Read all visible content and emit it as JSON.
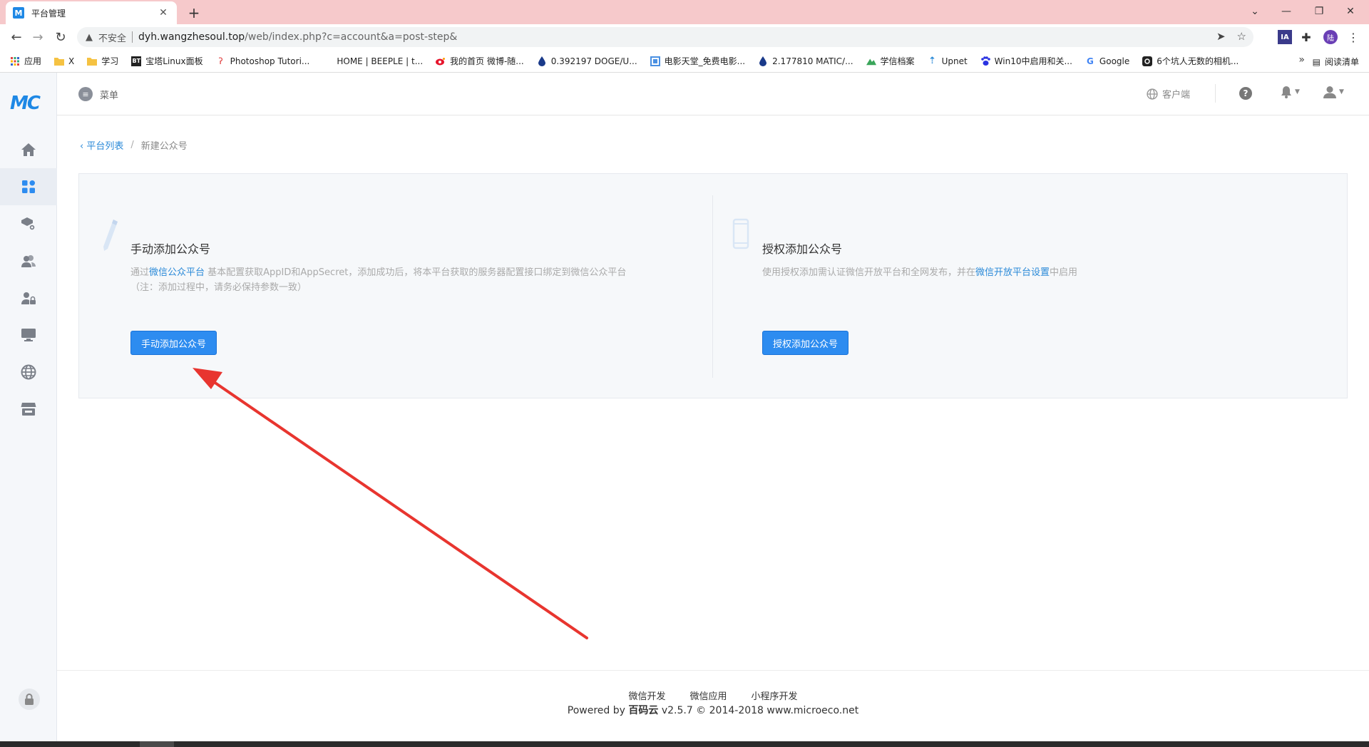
{
  "browser": {
    "tab_title": "平台管理",
    "tab_favicon_letter": "M",
    "url_security": "不安全",
    "url_host": "dyh.wangzhesoul.top",
    "url_path": "/web/index.php?c=account&a=post-step&",
    "profile_initial": "陆",
    "ext_label": "IA",
    "bookmarks": [
      {
        "label": "应用",
        "icon": "apps-grid-icon"
      },
      {
        "label": "X",
        "icon": "folder-icon"
      },
      {
        "label": "学习",
        "icon": "folder-icon"
      },
      {
        "label": "宝塔Linux面板",
        "icon": "bt-icon",
        "icon_text": "BT"
      },
      {
        "label": "Photoshop Tutori...",
        "icon": "photoshop-icon"
      },
      {
        "label": "HOME | BEEPLE | t...",
        "icon": "blank-icon"
      },
      {
        "label": "我的首页 微博-随...",
        "icon": "weibo-icon"
      },
      {
        "label": "0.392197 DOGE/U...",
        "icon": "drop-icon"
      },
      {
        "label": "电影天堂_免费电影...",
        "icon": "film-icon"
      },
      {
        "label": "2.177810 MATIC/...",
        "icon": "drop-icon"
      },
      {
        "label": "学信档案",
        "icon": "chsi-icon"
      },
      {
        "label": "Upnet",
        "icon": "upnet-icon"
      },
      {
        "label": "Win10中启用和关...",
        "icon": "baidu-icon"
      },
      {
        "label": "Google",
        "icon": "google-icon"
      },
      {
        "label": "6个坑人无数的相机...",
        "icon": "camera-icon"
      }
    ],
    "reading_list": "阅读清单"
  },
  "app": {
    "logo": "MC",
    "menu_label": "菜单",
    "client_label": "客户端",
    "help_glyph": "?",
    "breadcrumb": {
      "back_label": "平台列表",
      "separator": "/",
      "current": "新建公众号"
    },
    "manual": {
      "title": "手动添加公众号",
      "desc_prefix": "通过",
      "desc_link": "微信公众平台",
      "desc_suffix": " 基本配置获取AppID和AppSecret，添加成功后，将本平台获取的服务器配置接口绑定到微信公众平台",
      "desc_note": "（注：添加过程中，请务必保持参数一致）",
      "button": "手动添加公众号"
    },
    "authorize": {
      "title": "授权添加公众号",
      "desc_prefix": "使用授权添加需认证微信开放平台和全网发布，并在",
      "desc_link": "微信开放平台设置",
      "desc_suffix": "中启用",
      "button": "授权添加公众号"
    },
    "footer": {
      "links": [
        "微信开发",
        "微信应用",
        "小程序开发"
      ],
      "powered_prefix": "Powered by ",
      "powered_brand": "百码云",
      "powered_suffix": " v2.5.7 © 2014-2018 www.microeco.net"
    }
  },
  "colors": {
    "accent": "#2d8cf0",
    "link": "#2b8ad8",
    "annotation_arrow": "#e8352f",
    "tabbar_bg": "#f6c9cb"
  }
}
